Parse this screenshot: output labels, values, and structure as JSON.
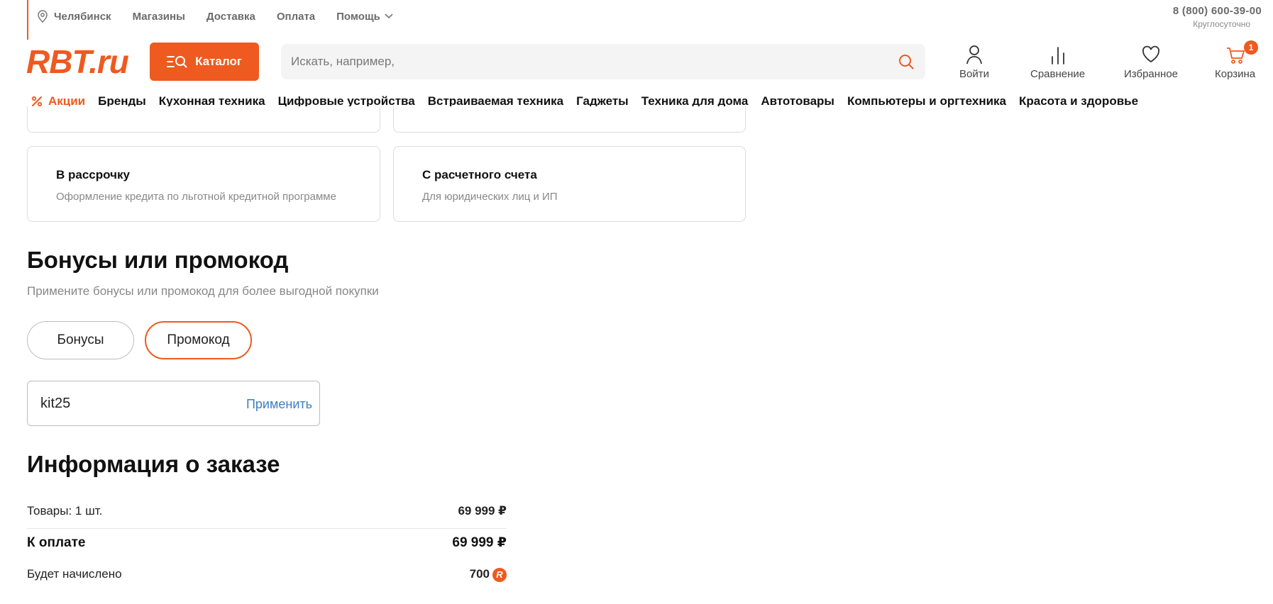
{
  "topbar": {
    "city": "Челябинск",
    "links": [
      "Магазины",
      "Доставка",
      "Оплата"
    ],
    "help": "Помощь",
    "phone": "8 (800) 600-39-00",
    "phone_note": "Круглосуточно"
  },
  "header": {
    "logo": "RBT.ru",
    "catalog_label": "Каталог",
    "search_placeholder": "Искать, например,",
    "icons": {
      "login": "Войти",
      "compare": "Сравнение",
      "favorites": "Избранное",
      "cart": "Корзина",
      "cart_count": "1"
    },
    "accent_color": "#ee5a1f"
  },
  "nav": {
    "promo": "Акции",
    "items": [
      "Бренды",
      "Кухонная техника",
      "Цифровые устройства",
      "Встраиваемая техника",
      "Гаджеты",
      "Техника для дома",
      "Автотовары",
      "Компьютеры и оргтехника",
      "Красота и здоровье"
    ]
  },
  "payment": {
    "options": [
      {
        "title": "В рассрочку",
        "desc": "Оформление кредита по льготной кредитной программе"
      },
      {
        "title": "С расчетного счета",
        "desc": "Для юридических лиц и ИП"
      }
    ]
  },
  "bonuses": {
    "title": "Бонусы или промокод",
    "subtitle": "Примените бонусы или промокод для более выгодной покупки",
    "tab_bonus": "Бонусы",
    "tab_promo": "Промокод",
    "promo_value": "kit25",
    "apply_label": "Применить"
  },
  "order": {
    "title": "Информация о заказе",
    "items_label": "Товары: 1 шт.",
    "items_amount": "69 999 ₽",
    "total_label": "К оплате",
    "total_amount": "69 999 ₽",
    "bonus_label": "Будет начислено",
    "bonus_amount": "700",
    "bonus_coin": "R"
  }
}
